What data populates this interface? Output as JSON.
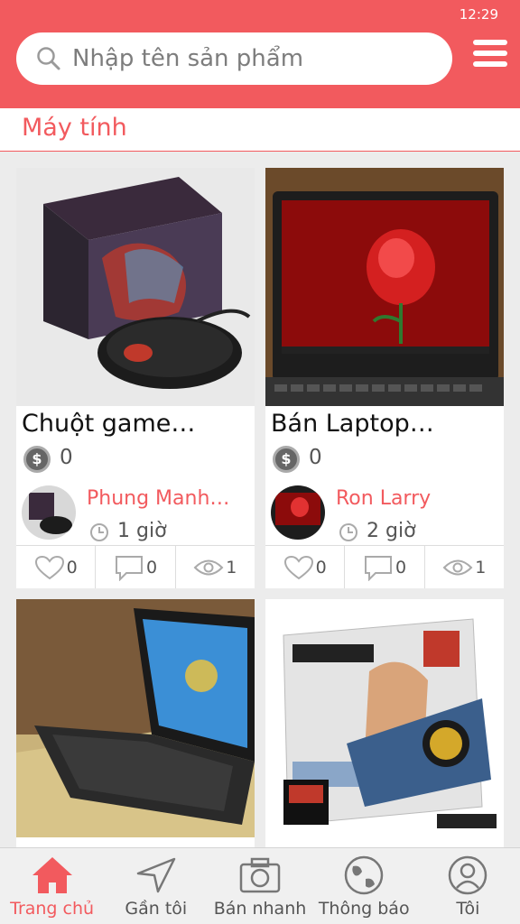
{
  "status": {
    "time": "12:29"
  },
  "search": {
    "placeholder": "Nhập tên sản phẩm"
  },
  "category": {
    "title": "Máy tính"
  },
  "products": [
    {
      "title": "Chuột game…",
      "price": "0",
      "seller": "Phung Manh…",
      "time": "1 giờ",
      "likes": "0",
      "comments": "0",
      "views": "1"
    },
    {
      "title": "Bán Laptop…",
      "price": "0",
      "seller": "Ron Larry",
      "time": "2 giờ",
      "likes": "0",
      "comments": "0",
      "views": "1"
    },
    {
      "title": ""
    },
    {
      "title": ""
    }
  ],
  "icons": {
    "price": "dollar-coin-icon",
    "time": "clock-icon",
    "likes": "heart-icon",
    "comments": "comment-icon",
    "views": "eye-icon"
  },
  "coin_symbol": "$",
  "tabs": [
    {
      "label": "Trang chủ",
      "icon": "home-icon",
      "active": true
    },
    {
      "label": "Gần tôi",
      "icon": "navigation-arrow-icon",
      "active": false
    },
    {
      "label": "Bán nhanh",
      "icon": "camera-icon",
      "active": false
    },
    {
      "label": "Thông báo",
      "icon": "globe-icon",
      "active": false
    },
    {
      "label": "Tôi",
      "icon": "user-icon",
      "active": false
    }
  ],
  "colors": {
    "accent": "#f25a5e",
    "background": "#ececec"
  }
}
